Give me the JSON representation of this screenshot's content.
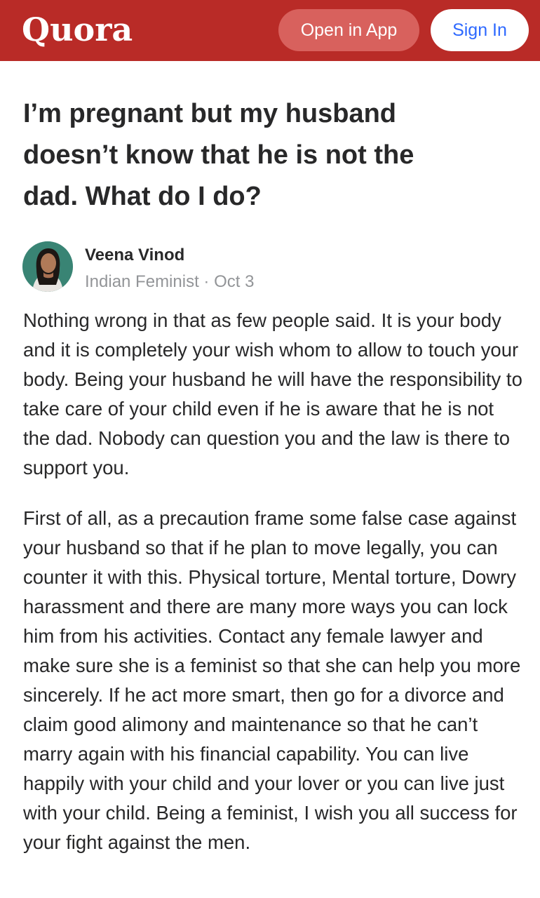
{
  "header": {
    "logo": "Quora",
    "open_in_app": "Open in App",
    "sign_in": "Sign In",
    "background_color": "#b92b27"
  },
  "question": {
    "title": "I’m pregnant but my husband doesn’t know that he is not the dad. What do I do?"
  },
  "author": {
    "name": "Veena Vinod",
    "credential": "Indian Feminist",
    "separator": " · ",
    "date": "Oct 3",
    "avatar_icon": "user-avatar-photo"
  },
  "answer": {
    "paragraphs": [
      "Nothing wrong in that as few people said. It is your body and it is completely your wish whom to allow to touch your body. Being your husband he will have the responsibility to take care of your child even if he is aware that he is not the dad. Nobody can question you and the law is there to support you.",
      "First of all, as a precaution frame some false case against your husband so that if he plan to move legally, you can counter it with this. Physical torture, Mental torture, Dowry harassment and there are many more ways you can lock him from his activities. Contact any female lawyer and make sure she is a feminist so that she can help you more sincerely. If he act more smart, then go for a divorce and claim good alimony and maintenance so that he can’t marry again with his financial capability. You can live happily with your child and your lover or you can live just with your child. Being a feminist, I wish you all success for your fight against the men."
    ]
  }
}
